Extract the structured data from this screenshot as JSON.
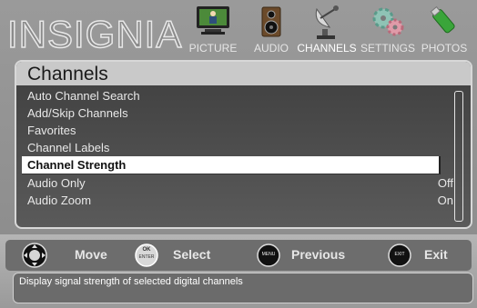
{
  "brand": {
    "logo_text": "INSIGNIA"
  },
  "tabs": [
    {
      "label": "PICTURE",
      "icon": "tv-icon",
      "active": false
    },
    {
      "label": "AUDIO",
      "icon": "speaker-icon",
      "active": false
    },
    {
      "label": "CHANNELS",
      "icon": "satellite-dish-icon",
      "active": true
    },
    {
      "label": "SETTINGS",
      "icon": "gears-icon",
      "active": false
    },
    {
      "label": "PHOTOS",
      "icon": "usb-drive-icon",
      "active": false
    }
  ],
  "panel": {
    "title": "Channels",
    "items": [
      {
        "label": "Auto Channel Search",
        "value": ""
      },
      {
        "label": "Add/Skip Channels",
        "value": ""
      },
      {
        "label": "Favorites",
        "value": ""
      },
      {
        "label": "Channel Labels",
        "value": ""
      },
      {
        "label": "Channel Strength",
        "value": "",
        "selected": true
      },
      {
        "label": "Audio Only",
        "value": "Off"
      },
      {
        "label": "Audio Zoom",
        "value": "On"
      }
    ]
  },
  "controls": {
    "move_label": "Move",
    "select_label": "Select",
    "ok_icon_top": "OK",
    "ok_icon_bottom": "ENTER",
    "previous_label": "Previous",
    "menu_icon_text": "MENU",
    "exit_label": "Exit",
    "exit_icon_text": "EXIT"
  },
  "help": {
    "text": "Display signal strength of selected digital channels"
  },
  "colors": {
    "background": "#8a8a8a",
    "panel_title_bg": "#c9c9c9",
    "selected_row_bg": "#ffffff"
  }
}
